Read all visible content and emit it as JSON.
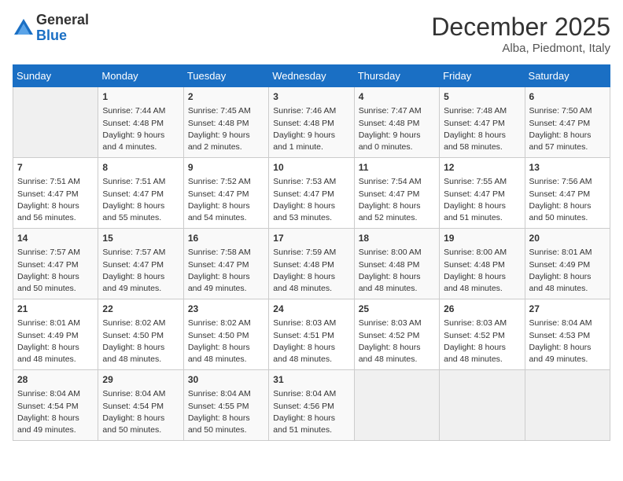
{
  "logo": {
    "general": "General",
    "blue": "Blue"
  },
  "title": {
    "month_year": "December 2025",
    "location": "Alba, Piedmont, Italy"
  },
  "days_of_week": [
    "Sunday",
    "Monday",
    "Tuesday",
    "Wednesday",
    "Thursday",
    "Friday",
    "Saturday"
  ],
  "weeks": [
    [
      {
        "day": "",
        "info": ""
      },
      {
        "day": "1",
        "info": "Sunrise: 7:44 AM\nSunset: 4:48 PM\nDaylight: 9 hours\nand 4 minutes."
      },
      {
        "day": "2",
        "info": "Sunrise: 7:45 AM\nSunset: 4:48 PM\nDaylight: 9 hours\nand 2 minutes."
      },
      {
        "day": "3",
        "info": "Sunrise: 7:46 AM\nSunset: 4:48 PM\nDaylight: 9 hours\nand 1 minute."
      },
      {
        "day": "4",
        "info": "Sunrise: 7:47 AM\nSunset: 4:48 PM\nDaylight: 9 hours\nand 0 minutes."
      },
      {
        "day": "5",
        "info": "Sunrise: 7:48 AM\nSunset: 4:47 PM\nDaylight: 8 hours\nand 58 minutes."
      },
      {
        "day": "6",
        "info": "Sunrise: 7:50 AM\nSunset: 4:47 PM\nDaylight: 8 hours\nand 57 minutes."
      }
    ],
    [
      {
        "day": "7",
        "info": "Sunrise: 7:51 AM\nSunset: 4:47 PM\nDaylight: 8 hours\nand 56 minutes."
      },
      {
        "day": "8",
        "info": "Sunrise: 7:51 AM\nSunset: 4:47 PM\nDaylight: 8 hours\nand 55 minutes."
      },
      {
        "day": "9",
        "info": "Sunrise: 7:52 AM\nSunset: 4:47 PM\nDaylight: 8 hours\nand 54 minutes."
      },
      {
        "day": "10",
        "info": "Sunrise: 7:53 AM\nSunset: 4:47 PM\nDaylight: 8 hours\nand 53 minutes."
      },
      {
        "day": "11",
        "info": "Sunrise: 7:54 AM\nSunset: 4:47 PM\nDaylight: 8 hours\nand 52 minutes."
      },
      {
        "day": "12",
        "info": "Sunrise: 7:55 AM\nSunset: 4:47 PM\nDaylight: 8 hours\nand 51 minutes."
      },
      {
        "day": "13",
        "info": "Sunrise: 7:56 AM\nSunset: 4:47 PM\nDaylight: 8 hours\nand 50 minutes."
      }
    ],
    [
      {
        "day": "14",
        "info": "Sunrise: 7:57 AM\nSunset: 4:47 PM\nDaylight: 8 hours\nand 50 minutes."
      },
      {
        "day": "15",
        "info": "Sunrise: 7:57 AM\nSunset: 4:47 PM\nDaylight: 8 hours\nand 49 minutes."
      },
      {
        "day": "16",
        "info": "Sunrise: 7:58 AM\nSunset: 4:47 PM\nDaylight: 8 hours\nand 49 minutes."
      },
      {
        "day": "17",
        "info": "Sunrise: 7:59 AM\nSunset: 4:48 PM\nDaylight: 8 hours\nand 48 minutes."
      },
      {
        "day": "18",
        "info": "Sunrise: 8:00 AM\nSunset: 4:48 PM\nDaylight: 8 hours\nand 48 minutes."
      },
      {
        "day": "19",
        "info": "Sunrise: 8:00 AM\nSunset: 4:48 PM\nDaylight: 8 hours\nand 48 minutes."
      },
      {
        "day": "20",
        "info": "Sunrise: 8:01 AM\nSunset: 4:49 PM\nDaylight: 8 hours\nand 48 minutes."
      }
    ],
    [
      {
        "day": "21",
        "info": "Sunrise: 8:01 AM\nSunset: 4:49 PM\nDaylight: 8 hours\nand 48 minutes."
      },
      {
        "day": "22",
        "info": "Sunrise: 8:02 AM\nSunset: 4:50 PM\nDaylight: 8 hours\nand 48 minutes."
      },
      {
        "day": "23",
        "info": "Sunrise: 8:02 AM\nSunset: 4:50 PM\nDaylight: 8 hours\nand 48 minutes."
      },
      {
        "day": "24",
        "info": "Sunrise: 8:03 AM\nSunset: 4:51 PM\nDaylight: 8 hours\nand 48 minutes."
      },
      {
        "day": "25",
        "info": "Sunrise: 8:03 AM\nSunset: 4:52 PM\nDaylight: 8 hours\nand 48 minutes."
      },
      {
        "day": "26",
        "info": "Sunrise: 8:03 AM\nSunset: 4:52 PM\nDaylight: 8 hours\nand 48 minutes."
      },
      {
        "day": "27",
        "info": "Sunrise: 8:04 AM\nSunset: 4:53 PM\nDaylight: 8 hours\nand 49 minutes."
      }
    ],
    [
      {
        "day": "28",
        "info": "Sunrise: 8:04 AM\nSunset: 4:54 PM\nDaylight: 8 hours\nand 49 minutes."
      },
      {
        "day": "29",
        "info": "Sunrise: 8:04 AM\nSunset: 4:54 PM\nDaylight: 8 hours\nand 50 minutes."
      },
      {
        "day": "30",
        "info": "Sunrise: 8:04 AM\nSunset: 4:55 PM\nDaylight: 8 hours\nand 50 minutes."
      },
      {
        "day": "31",
        "info": "Sunrise: 8:04 AM\nSunset: 4:56 PM\nDaylight: 8 hours\nand 51 minutes."
      },
      {
        "day": "",
        "info": ""
      },
      {
        "day": "",
        "info": ""
      },
      {
        "day": "",
        "info": ""
      }
    ]
  ]
}
